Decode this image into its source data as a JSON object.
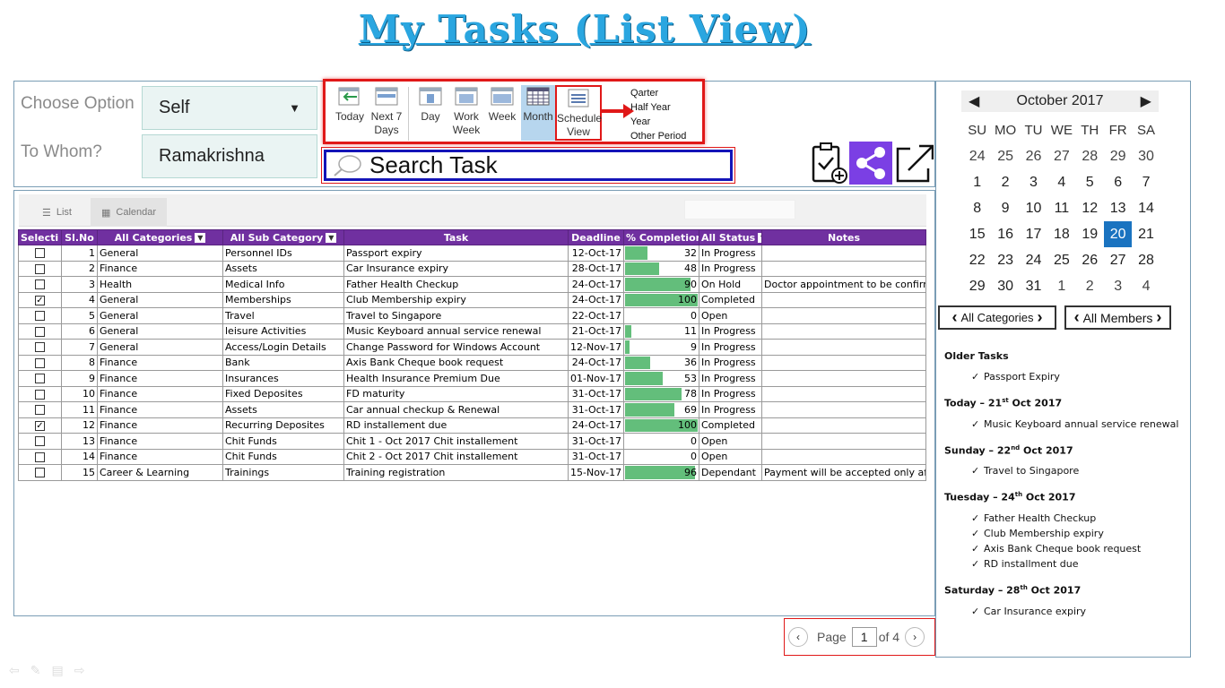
{
  "title": "My Tasks (List View)",
  "options": {
    "choose_label": "Choose Option",
    "choose_value": "Self",
    "whom_label": "To Whom?",
    "whom_value": "Ramakrishna"
  },
  "ribbon": {
    "today": "Today",
    "next7_1": "Next 7",
    "next7_2": "Days",
    "day": "Day",
    "work_1": "Work",
    "work_2": "Week",
    "week": "Week",
    "month": "Month",
    "schedule_1": "Schedule",
    "schedule_2": "View",
    "periods": [
      "Qarter",
      "Half Year",
      "Year",
      "Other Period"
    ]
  },
  "search": {
    "placeholder": "Search Task"
  },
  "tabs": {
    "list": "List",
    "calendar": "Calendar"
  },
  "grid": {
    "headers": [
      "Selecti",
      "Sl.No",
      "All Categories",
      "All Sub Category",
      "Task",
      "Deadline",
      "% Completion",
      "All Status",
      "Notes"
    ],
    "rows": [
      {
        "checked": false,
        "sl": "1",
        "cat": "General",
        "sub": "Personnel IDs",
        "task": "Passport expiry",
        "deadline": "12-Oct-17",
        "pct": 32,
        "status": "In Progress",
        "notes": ""
      },
      {
        "checked": false,
        "sl": "2",
        "cat": "Finance",
        "sub": "Assets",
        "task": "Car Insurance expiry",
        "deadline": "28-Oct-17",
        "pct": 48,
        "status": "In Progress",
        "notes": ""
      },
      {
        "checked": false,
        "sl": "3",
        "cat": "Health",
        "sub": "Medical Info",
        "task": "Father Health Checkup",
        "deadline": "24-Oct-17",
        "pct": 90,
        "status": "On Hold",
        "notes": "Doctor appointment to be confirmed…"
      },
      {
        "checked": true,
        "sl": "4",
        "cat": "General",
        "sub": "Memberships",
        "task": "Club Membership expiry",
        "deadline": "24-Oct-17",
        "pct": 100,
        "status": "Completed",
        "notes": ""
      },
      {
        "checked": false,
        "sl": "5",
        "cat": "General",
        "sub": "Travel",
        "task": "Travel to Singapore",
        "deadline": "22-Oct-17",
        "pct": 0,
        "status": "Open",
        "notes": ""
      },
      {
        "checked": false,
        "sl": "6",
        "cat": "General",
        "sub": "leisure Activities",
        "task": "Music Keyboard annual service renewal",
        "deadline": "21-Oct-17",
        "pct": 11,
        "status": "In Progress",
        "notes": ""
      },
      {
        "checked": false,
        "sl": "7",
        "cat": "General",
        "sub": "Access/Login Details",
        "task": "Change Password for Windows Account",
        "deadline": "12-Nov-17",
        "pct": 9,
        "status": "In Progress",
        "notes": ""
      },
      {
        "checked": false,
        "sl": "8",
        "cat": "Finance",
        "sub": "Bank",
        "task": "Axis Bank Cheque book request",
        "deadline": "24-Oct-17",
        "pct": 36,
        "status": "In Progress",
        "notes": ""
      },
      {
        "checked": false,
        "sl": "9",
        "cat": "Finance",
        "sub": "Insurances",
        "task": "Health Insurance Premium Due",
        "deadline": "01-Nov-17",
        "pct": 53,
        "status": "In Progress",
        "notes": ""
      },
      {
        "checked": false,
        "sl": "10",
        "cat": "Finance",
        "sub": "Fixed Deposites",
        "task": "FD maturity",
        "deadline": "31-Oct-17",
        "pct": 78,
        "status": "In Progress",
        "notes": ""
      },
      {
        "checked": false,
        "sl": "11",
        "cat": "Finance",
        "sub": "Assets",
        "task": "Car annual checkup & Renewal",
        "deadline": "31-Oct-17",
        "pct": 69,
        "status": "In Progress",
        "notes": ""
      },
      {
        "checked": true,
        "sl": "12",
        "cat": "Finance",
        "sub": "Recurring Deposites",
        "task": "RD installement due",
        "deadline": "24-Oct-17",
        "pct": 100,
        "status": "Completed",
        "notes": ""
      },
      {
        "checked": false,
        "sl": "13",
        "cat": "Finance",
        "sub": "Chit Funds",
        "task": "Chit 1 - Oct 2017 Chit installement",
        "deadline": "31-Oct-17",
        "pct": 0,
        "status": "Open",
        "notes": ""
      },
      {
        "checked": false,
        "sl": "14",
        "cat": "Finance",
        "sub": "Chit Funds",
        "task": "Chit 2 - Oct 2017 Chit installement",
        "deadline": "31-Oct-17",
        "pct": 0,
        "status": "Open",
        "notes": ""
      },
      {
        "checked": false,
        "sl": "15",
        "cat": "Career & Learning",
        "sub": "Trainings",
        "task": "Training registration",
        "deadline": "15-Nov-17",
        "pct": 96,
        "status": "Dependant",
        "notes": "Payment will be accepted only after the"
      }
    ]
  },
  "pager": {
    "label": "Page",
    "current": "1",
    "of": "of 4"
  },
  "calendar": {
    "month": "October 2017",
    "dow": [
      "SU",
      "MO",
      "TU",
      "WE",
      "TH",
      "FR",
      "SA"
    ],
    "days": [
      {
        "d": "24",
        "other": true
      },
      {
        "d": "25",
        "other": true
      },
      {
        "d": "26",
        "other": true
      },
      {
        "d": "27",
        "other": true
      },
      {
        "d": "28",
        "other": true
      },
      {
        "d": "29",
        "other": true
      },
      {
        "d": "30",
        "other": true
      },
      {
        "d": "1"
      },
      {
        "d": "2"
      },
      {
        "d": "3"
      },
      {
        "d": "4"
      },
      {
        "d": "5"
      },
      {
        "d": "6"
      },
      {
        "d": "7"
      },
      {
        "d": "8"
      },
      {
        "d": "9"
      },
      {
        "d": "10"
      },
      {
        "d": "11"
      },
      {
        "d": "12"
      },
      {
        "d": "13"
      },
      {
        "d": "14"
      },
      {
        "d": "15"
      },
      {
        "d": "16"
      },
      {
        "d": "17"
      },
      {
        "d": "18"
      },
      {
        "d": "19"
      },
      {
        "d": "20",
        "today": true
      },
      {
        "d": "21"
      },
      {
        "d": "22"
      },
      {
        "d": "23"
      },
      {
        "d": "24"
      },
      {
        "d": "25"
      },
      {
        "d": "26"
      },
      {
        "d": "27"
      },
      {
        "d": "28"
      },
      {
        "d": "29"
      },
      {
        "d": "30"
      },
      {
        "d": "31"
      },
      {
        "d": "1",
        "other": true
      },
      {
        "d": "2",
        "other": true
      },
      {
        "d": "3",
        "other": true
      },
      {
        "d": "4",
        "other": true
      }
    ]
  },
  "filters": {
    "categories": "All Categories",
    "members": "All Members"
  },
  "agenda": [
    {
      "head": "Older Tasks",
      "items": [
        "Passport Expiry"
      ]
    },
    {
      "head_pre": "Today – 21",
      "sup": "st",
      "head_post": " Oct 2017",
      "items": [
        "Music Keyboard annual service renewal"
      ]
    },
    {
      "head_pre": "Sunday – 22",
      "sup": "nd",
      "head_post": " Oct 2017",
      "items": [
        "Travel to Singapore"
      ]
    },
    {
      "head_pre": "Tuesday – 24",
      "sup": "th",
      "head_post": " Oct 2017",
      "items": [
        "Father Health Checkup",
        "Club Membership expiry",
        "Axis Bank Cheque book request",
        "RD installment due"
      ]
    },
    {
      "head_pre": "Saturday – 28",
      "sup": "th",
      "head_post": " Oct 2017",
      "items": [
        "Car Insurance expiry"
      ]
    }
  ],
  "colors": {
    "header": "#7030a0",
    "bar": "#63be7b",
    "today": "#1a73c0",
    "accent_red": "#e01818",
    "search_border": "#1414b8",
    "share_icon_bg": "#7b3fe4"
  }
}
